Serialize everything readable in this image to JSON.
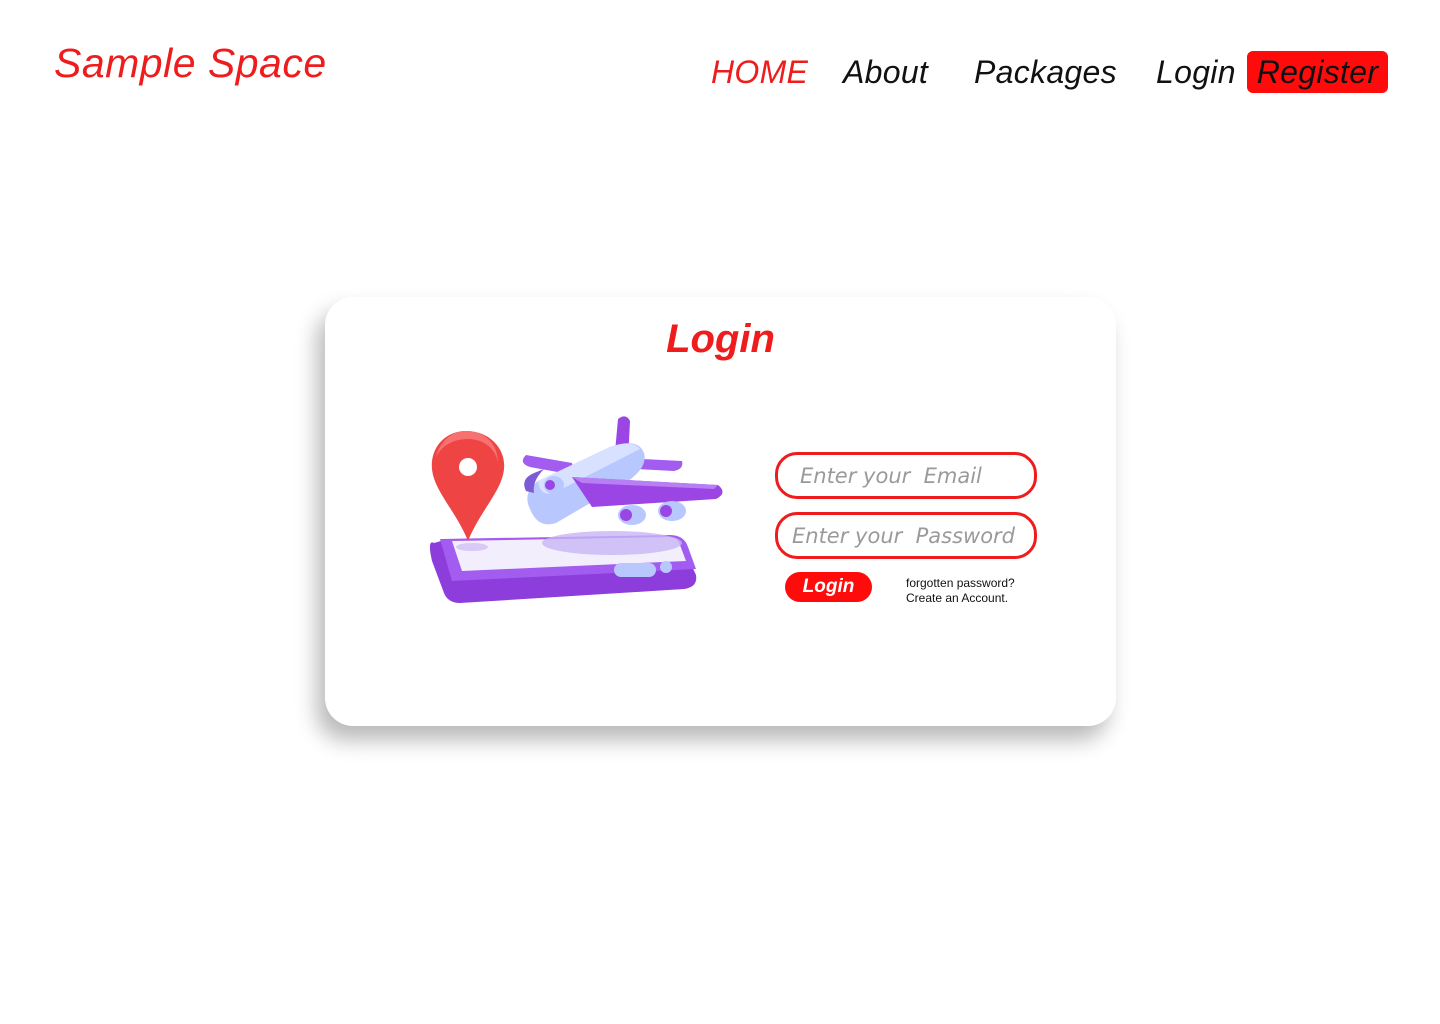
{
  "header": {
    "brand": "Sample Space",
    "nav": {
      "home": "HOME",
      "about": "About",
      "packages": "Packages",
      "login": "Login",
      "register": "Register"
    }
  },
  "login_card": {
    "title": "Login",
    "email_placeholder": "Enter your  Email",
    "password_placeholder": "Enter your  Password",
    "login_button": "Login",
    "forgot_password": "forgotten password?",
    "create_account": "Create an Account."
  },
  "colors": {
    "accent": "#ee1c1c",
    "register_bg": "#ff0b0b",
    "illustration_purple": "#9b45e4",
    "illustration_pin": "#ef4444",
    "illustration_plane": "#b8c8ff"
  },
  "icons": {
    "illustration": "travel-plane-phone-location-pin"
  }
}
